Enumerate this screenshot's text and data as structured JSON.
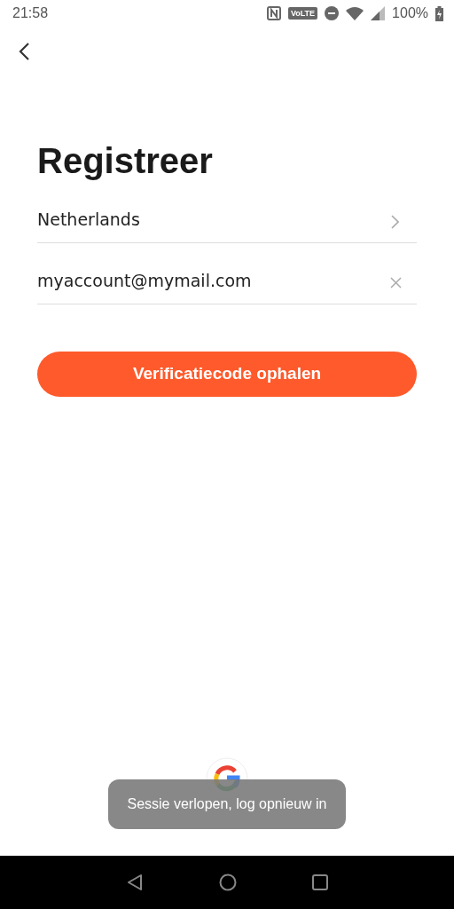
{
  "status_bar": {
    "time": "21:58",
    "volte": "VoLTE",
    "battery": "100%"
  },
  "title": "Registreer",
  "country": {
    "value": "Netherlands"
  },
  "email": {
    "value": "myaccount@mymail.com"
  },
  "submit_button": {
    "label": "Verificatiecode ophalen"
  },
  "toast": {
    "message": "Sessie verlopen, log opnieuw in"
  }
}
